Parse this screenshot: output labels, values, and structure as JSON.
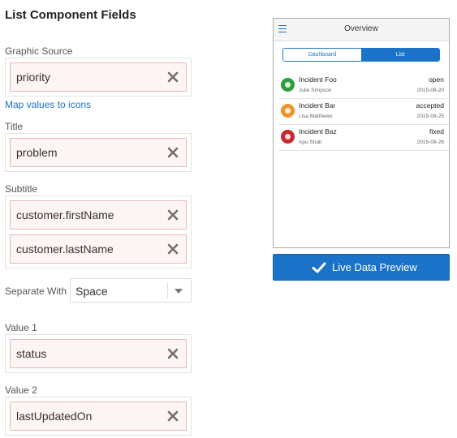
{
  "title": "List Component Fields",
  "graphic_source": {
    "label": "Graphic Source",
    "value": "priority",
    "link": "Map values to icons"
  },
  "title_field": {
    "label": "Title",
    "value": "problem"
  },
  "subtitle_field": {
    "label": "Subtitle",
    "values": [
      "customer.firstName",
      "customer.lastName"
    ]
  },
  "separator": {
    "label": "Separate With",
    "value": "Space"
  },
  "value1": {
    "label": "Value 1",
    "value": "status"
  },
  "value2": {
    "label": "Value 2",
    "value": "lastUpdatedOn"
  },
  "clear_icon": "close-icon",
  "preview": {
    "header_title": "Overview",
    "tabs": [
      "Dashboard",
      "List"
    ],
    "active_tab": "List",
    "items": [
      {
        "title": "Incident Foo",
        "status": "open",
        "person": "Julie Simpson",
        "date": "2015-08-20",
        "color": "#2e9e3e"
      },
      {
        "title": "Incident Bar",
        "status": "accepted",
        "person": "Lisa Matthews",
        "date": "2015-08-25",
        "color": "#f0932b"
      },
      {
        "title": "Incident Baz",
        "status": "fixed",
        "person": "Apu Shah",
        "date": "2015-08-26",
        "color": "#c9252c"
      }
    ]
  },
  "live_preview_button": "Live Data Preview",
  "colors": {
    "accent": "#1a73c8",
    "chip_border": "#e8b7b7",
    "chip_bg": "#fdf4f4"
  }
}
